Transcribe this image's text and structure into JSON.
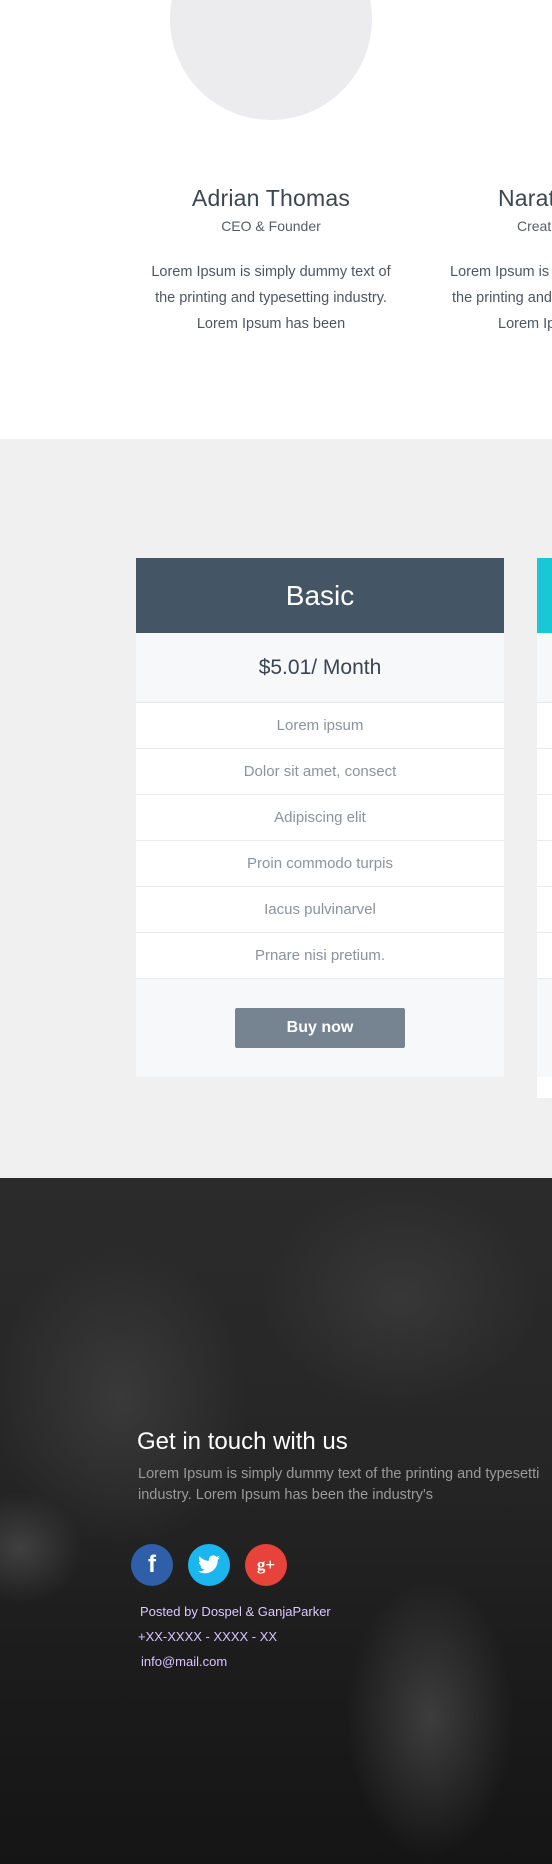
{
  "team": {
    "members": [
      {
        "name": "Adrian Thomas",
        "role": "CEO & Founder",
        "bio_lines": [
          "Lorem Ipsum is simply dummy text of",
          "the printing and typesetting industry.",
          "Lorem Ipsum has been"
        ]
      },
      {
        "name": "Narat",
        "role": "Creat",
        "bio_lines": [
          "Lorem Ipsum is",
          "the printing and",
          "Lorem Ip"
        ]
      }
    ]
  },
  "pricing": {
    "plans": [
      {
        "title": "Basic",
        "price": "$5.01/ Month",
        "features": [
          "Lorem ipsum",
          "Dolor sit amet, consect",
          "Adipiscing elit",
          "Proin commodo turpis",
          "Iacus pulvinarvel",
          "Prnare nisi pretium."
        ],
        "button_label": "Buy now",
        "header_color": "#445565"
      }
    ],
    "next_plan_accent": "#16c9d4"
  },
  "contact": {
    "title": "Get in touch with us",
    "text_lines": [
      "Lorem Ipsum is simply dummy text of the printing and typesetti",
      "industry. Lorem Ipsum has been the industry's"
    ],
    "social": [
      {
        "icon": "facebook-icon",
        "glyph": "f",
        "color": "#2e5fa8"
      },
      {
        "icon": "twitter-icon",
        "color": "#1bb6ee"
      },
      {
        "icon": "google-plus-icon",
        "glyph": "g+",
        "color": "#e8433a"
      }
    ],
    "posted_by": "Posted by Dospel & GanjaParker",
    "phone": "+XX-XXXX - XXXX - XX",
    "email": "info@mail.com"
  }
}
